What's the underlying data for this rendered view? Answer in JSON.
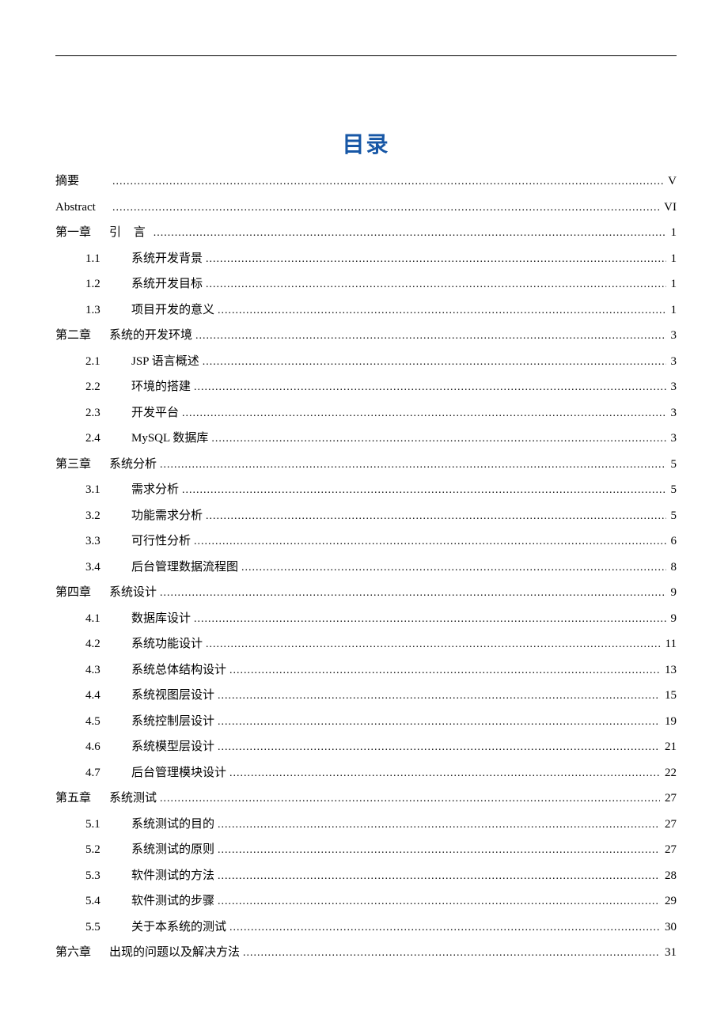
{
  "title": "目录",
  "toc": [
    {
      "level": 0,
      "prefix": "摘要",
      "label": "",
      "page": "V"
    },
    {
      "level": 0,
      "prefix": "Abstract",
      "label": "",
      "page": "VI"
    },
    {
      "level": 0,
      "prefix": "第一章",
      "label": "引 言",
      "page": "1",
      "spaced": true
    },
    {
      "level": 1,
      "prefix": "1.1",
      "label": "系统开发背景",
      "page": "1"
    },
    {
      "level": 1,
      "prefix": "1.2",
      "label": "系统开发目标",
      "page": "1"
    },
    {
      "level": 1,
      "prefix": "1.3",
      "label": "项目开发的意义",
      "page": "1"
    },
    {
      "level": 0,
      "prefix": "第二章",
      "label": "系统的开发环境",
      "page": "3"
    },
    {
      "level": 1,
      "prefix": "2.1",
      "label": "JSP 语言概述",
      "page": "3"
    },
    {
      "level": 1,
      "prefix": "2.2",
      "label": "环境的搭建",
      "page": "3"
    },
    {
      "level": 1,
      "prefix": "2.3",
      "label": "开发平台",
      "page": "3"
    },
    {
      "level": 1,
      "prefix": "2.4",
      "label": "MySQL 数据库",
      "page": "3"
    },
    {
      "level": 0,
      "prefix": "第三章",
      "label": "系统分析",
      "page": "5"
    },
    {
      "level": 1,
      "prefix": "3.1",
      "label": "需求分析",
      "page": "5"
    },
    {
      "level": 1,
      "prefix": "3.2",
      "label": "功能需求分析",
      "page": "5"
    },
    {
      "level": 1,
      "prefix": "3.3",
      "label": "可行性分析",
      "page": "6"
    },
    {
      "level": 1,
      "prefix": "3.4",
      "label": "后台管理数据流程图",
      "page": "8"
    },
    {
      "level": 0,
      "prefix": "第四章",
      "label": "系统设计",
      "page": "9"
    },
    {
      "level": 1,
      "prefix": "4.1",
      "label": "数据库设计",
      "page": "9"
    },
    {
      "level": 1,
      "prefix": "4.2",
      "label": "系统功能设计",
      "page": "11"
    },
    {
      "level": 1,
      "prefix": "4.3",
      "label": "系统总体结构设计",
      "page": "13"
    },
    {
      "level": 1,
      "prefix": "4.4",
      "label": "系统视图层设计",
      "page": "15"
    },
    {
      "level": 1,
      "prefix": "4.5",
      "label": "系统控制层设计",
      "page": "19"
    },
    {
      "level": 1,
      "prefix": "4.6",
      "label": "系统模型层设计",
      "page": "21"
    },
    {
      "level": 1,
      "prefix": "4.7",
      "label": "后台管理模块设计",
      "page": "22"
    },
    {
      "level": 0,
      "prefix": "第五章",
      "label": "系统测试",
      "page": "27"
    },
    {
      "level": 1,
      "prefix": "5.1",
      "label": "系统测试的目的",
      "page": "27"
    },
    {
      "level": 1,
      "prefix": "5.2",
      "label": "系统测试的原则",
      "page": "27"
    },
    {
      "level": 1,
      "prefix": "5.3",
      "label": "软件测试的方法",
      "page": "28"
    },
    {
      "level": 1,
      "prefix": "5.4",
      "label": "软件测试的步骤",
      "page": "29"
    },
    {
      "level": 1,
      "prefix": "5.5",
      "label": "关于本系统的测试",
      "page": "30"
    },
    {
      "level": 0,
      "prefix": "第六章",
      "label": "出现的问题以及解决方法",
      "page": "31"
    }
  ]
}
